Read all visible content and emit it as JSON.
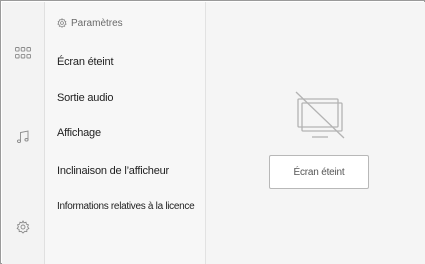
{
  "rail": {
    "items": [
      {
        "icon": "apps-grid-icon"
      },
      {
        "icon": "music-note-icon"
      },
      {
        "icon": "settings-gear-icon"
      }
    ]
  },
  "menu": {
    "header": {
      "icon": "gear-icon",
      "label": "Paramètres"
    },
    "items": [
      {
        "label": "Écran éteint"
      },
      {
        "label": "Sortie audio"
      },
      {
        "label": "Affichage"
      },
      {
        "label": "Inclinaison de l’afficheur"
      },
      {
        "label": "Informations relatives à la licence"
      }
    ]
  },
  "content": {
    "graphic_icon": "screen-off-icon",
    "button_label": "Écran éteint"
  }
}
